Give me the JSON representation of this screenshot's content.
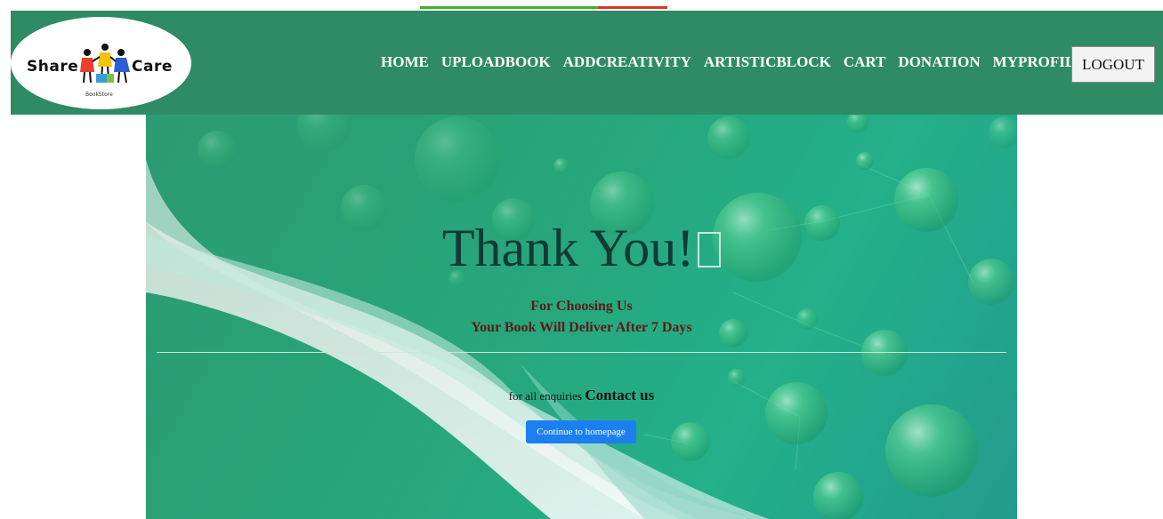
{
  "brand": {
    "name_left": "Share",
    "name_right": "Care",
    "tagline": "BookStore"
  },
  "nav": {
    "links": [
      "HOME",
      "UPLOADBOOK",
      "ADDCREATIVITY",
      "ARTISTICBLOCK",
      "CART",
      "DONATION",
      "MYPROFILE"
    ],
    "logout_label": "LOGOUT"
  },
  "hero": {
    "title": "Thank You!",
    "line1": "For Choosing Us",
    "line2": "Your Book Will Deliver After 7 Days",
    "enquiry_prefix": "for all enquiries",
    "contact_link": "Contact us",
    "cta_label": "Continue to homepage"
  },
  "colors": {
    "navbar": "#2e8b66",
    "cta": "#1b7ff0",
    "title": "#123a34",
    "subtitle": "#5c1b16"
  }
}
